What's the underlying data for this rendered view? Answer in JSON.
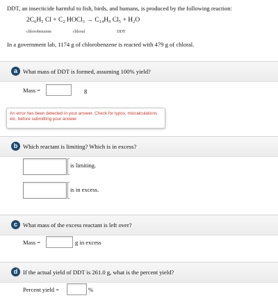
{
  "intro": {
    "text": "DDT, an insecticide harmful to fish, birds, and humans, is produced by the following reaction:",
    "equation": "2C₆H₅ Cl + C₂ HOCl₃ → C₁₄H₉ Cl₅ + H₂O",
    "label_chlorobenzene": "chlorobenzene",
    "label_chloral": "chloral",
    "label_ddt": "DDT",
    "lab_statement": "In a government lab, 1174 g of chlorobenzene is reacted with 479 g of chloral."
  },
  "part_a": {
    "badge": "a",
    "question": "What mass of DDT is formed, assuming 100% yield?",
    "field_label": "Mass =",
    "value": "",
    "unit": "g",
    "error": "An error has been detected in your answer. Check for typos, miscalculations etc. before submitting your answer."
  },
  "part_b": {
    "badge": "b",
    "question": "Which reactant is limiting? Which is in excess?",
    "limiting_label": "is limiting.",
    "excess_label": "is in excess."
  },
  "part_c": {
    "badge": "c",
    "question": "What mass of the excess reactant is left over?",
    "field_label": "Mass =",
    "value": "",
    "unit": "g in excess"
  },
  "part_d": {
    "badge": "d",
    "question": "If the actual yield of DDT is 261.0 g, what is the percent yield?",
    "field_label": "Percent yield =",
    "value": "",
    "unit": "%"
  }
}
